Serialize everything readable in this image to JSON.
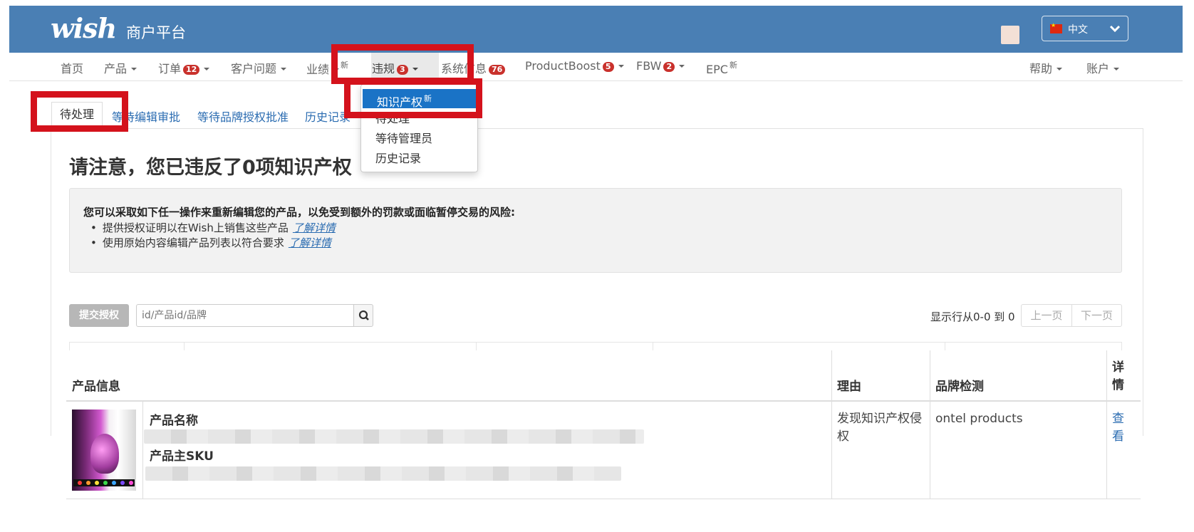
{
  "header": {
    "logo": "wish",
    "platform": "商户平台",
    "language": "中文"
  },
  "nav": {
    "home": "首页",
    "products": "产品",
    "orders": "订单",
    "orders_badge": "12",
    "customer_issues": "客户问题",
    "performance": "业绩",
    "performance_sup": "新",
    "violations": "违规",
    "violations_badge": "3",
    "system_info": "系统信息",
    "system_info_badge": "76",
    "productboost": "ProductBoost",
    "productboost_badge": "5",
    "fbw": "FBW",
    "fbw_badge": "2",
    "epc": "EPC",
    "epc_sup": "新",
    "help": "帮助",
    "account": "账户"
  },
  "dropdown": {
    "items": [
      {
        "label": "知识产权",
        "sup": "新"
      },
      {
        "label": "待处理"
      },
      {
        "label": "等待管理员"
      },
      {
        "label": "历史记录"
      }
    ]
  },
  "subtabs": {
    "pending": "待处理",
    "awaiting_edit": "等待编辑审批",
    "awaiting_brand": "等待品牌授权批准",
    "history": "历史记录"
  },
  "main": {
    "heading": "请注意，您已违反了0项知识产权",
    "notice_title": "您可以采取如下任一操作来重新编辑您的产品，以免受到额外的罚款或面临暂停交易的风险:",
    "notice_items": [
      {
        "text": "提供授权证明以在Wish上销售这些产品",
        "link": "了解详情"
      },
      {
        "text": "使用原始内容编辑产品列表以符合要求",
        "link": "了解详情"
      }
    ]
  },
  "toolbar": {
    "submit_label": "提交授权",
    "search_placeholder": "id/产品id/品牌",
    "range_text": "显示行从0-0 到 0",
    "prev": "上一页",
    "next": "下一页"
  },
  "table": {
    "headers": {
      "product_info": "产品信息",
      "reason": "理由",
      "brand_detection": "品牌检测",
      "details": "详情"
    },
    "rows": [
      {
        "product_name_label": "产品名称",
        "product_sku_label": "产品主SKU",
        "reason": "发现知识产权侵权",
        "brand": "ontel products",
        "details_link": "查看"
      }
    ]
  },
  "colors": {
    "header_bg": "#4a7fb4",
    "highlight": "#d4121c",
    "badge": "#c9312c",
    "link": "#2b6cb1",
    "selected": "#1a73c6"
  }
}
